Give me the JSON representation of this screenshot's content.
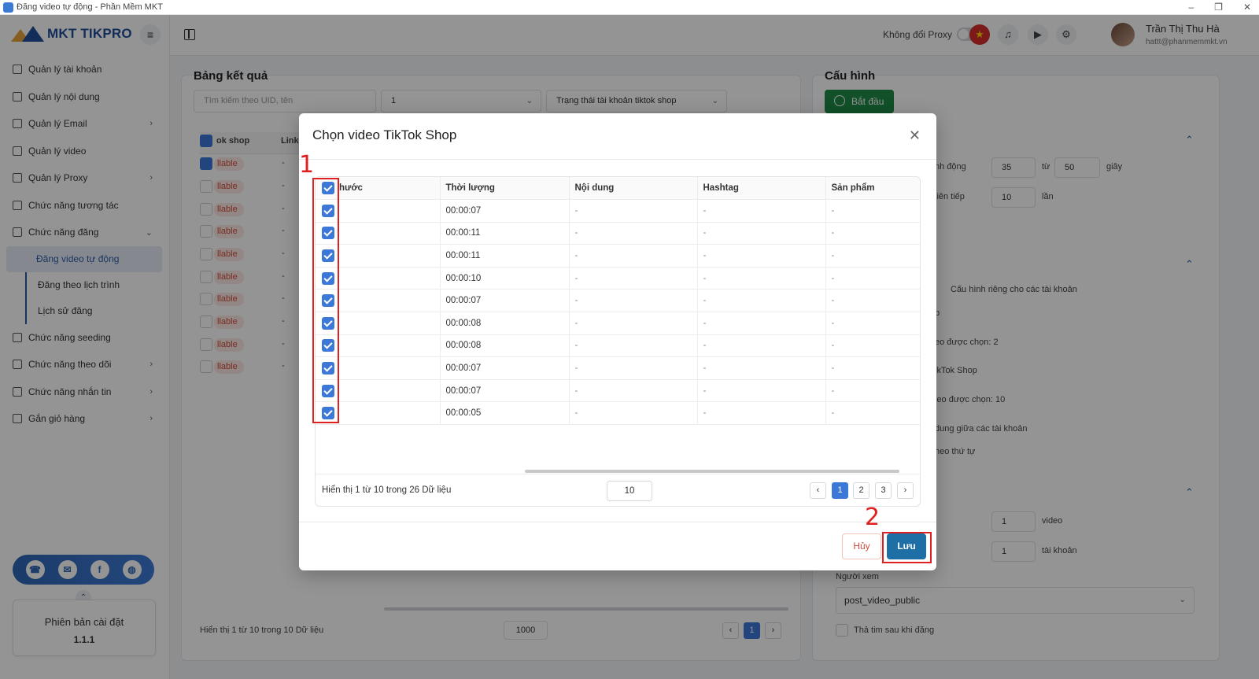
{
  "window": {
    "title": "Đăng video tự động - Phần Mềm MKT",
    "controls": [
      "–",
      "❐",
      "✕"
    ]
  },
  "sidebar": {
    "logo_text": "MKT TIKPRO",
    "items": [
      {
        "label": "Quản lý tài khoản",
        "icon": "grid-icon"
      },
      {
        "label": "Quản lý nội dung",
        "icon": "content-icon"
      },
      {
        "label": "Quản lý Email",
        "icon": "mail-icon",
        "chevron": "›"
      },
      {
        "label": "Quản lý video",
        "icon": "video-icon"
      },
      {
        "label": "Quản lý Proxy",
        "icon": "proxy-icon",
        "chevron": "›"
      },
      {
        "label": "Chức năng tương tác",
        "icon": "interact-icon"
      },
      {
        "label": "Chức năng đăng",
        "icon": "post-icon",
        "chevron": "⌄"
      }
    ],
    "sub_items": [
      {
        "label": "Đăng video tự động",
        "active": true
      },
      {
        "label": "Đăng theo lịch trình",
        "active": false
      },
      {
        "label": "Lịch sử đăng",
        "active": false
      }
    ],
    "items_after": [
      {
        "label": "Chức năng seeding",
        "icon": "seeding-icon"
      },
      {
        "label": "Chức năng theo dõi",
        "icon": "follow-icon",
        "chevron": "›"
      },
      {
        "label": "Chức năng nhắn tin",
        "icon": "message-icon",
        "chevron": "›"
      },
      {
        "label": "Gắn giỏ hàng",
        "icon": "cart-icon",
        "chevron": "›"
      }
    ],
    "version_label": "Phiên bản cài đặt",
    "version_number": "1.1.1"
  },
  "header": {
    "proxy_label": "Không đổi Proxy",
    "user_name": "Trần Thị Thu Hà",
    "user_email": "hattt@phanmemmkt.vn"
  },
  "results_panel": {
    "title": "Bảng kết quả",
    "search_placeholder": "Tìm kiếm theo UID, tên",
    "filter_value": "1",
    "status_placeholder": "Trạng thái tài khoản tiktok shop",
    "col_shop": "ok shop",
    "col_link": "Link",
    "badge_text": "llable",
    "dash": "-",
    "footer_text": "Hiển thị 1 từ 10 trong 10 Dữ liệu",
    "page_size": "1000",
    "page": "1"
  },
  "config_panel": {
    "title": "Cấu hình",
    "start_label": "Bắt đầu",
    "row1_label": "nh động",
    "row1_from": "35",
    "row1_to_label": "từ",
    "row1_to": "50",
    "row1_unit": "giây",
    "row2_label": "liên tiếp",
    "row2_value": "10",
    "row2_unit": "lần",
    "rieng_label": "Cấu hình riêng cho các tài khoản",
    "p_label": "p",
    "video_selected_1": "eo được chọn: 2",
    "tiktok_shop_label": "ikTok Shop",
    "video_selected_2": "leo được chọn: 10",
    "dung_label": "dung giữa các tài khoản",
    "order_label": "heo thứ tự",
    "v1": "1",
    "v1_unit": "video",
    "v2": "1",
    "v2_unit": "tài khoản",
    "viewer_label": "Người xem",
    "viewer_value": "post_video_public",
    "heart_label": "Thả tim sau khi đăng"
  },
  "modal": {
    "title": "Chọn video TikTok Shop",
    "columns": [
      "hước",
      "Thời lượng",
      "Nội dung",
      "Hashtag",
      "Sản phẩm"
    ],
    "rows": [
      {
        "duration": "00:00:07",
        "content": "-",
        "hashtag": "-",
        "product": "-"
      },
      {
        "duration": "00:00:11",
        "content": "-",
        "hashtag": "-",
        "product": "-"
      },
      {
        "duration": "00:00:11",
        "content": "-",
        "hashtag": "-",
        "product": "-"
      },
      {
        "duration": "00:00:10",
        "content": "-",
        "hashtag": "-",
        "product": "-"
      },
      {
        "duration": "00:00:07",
        "content": "-",
        "hashtag": "-",
        "product": "-"
      },
      {
        "duration": "00:00:08",
        "content": "-",
        "hashtag": "-",
        "product": "-"
      },
      {
        "duration": "00:00:08",
        "content": "-",
        "hashtag": "-",
        "product": "-"
      },
      {
        "duration": "00:00:07",
        "content": "-",
        "hashtag": "-",
        "product": "-"
      },
      {
        "duration": "00:00:07",
        "content": "-",
        "hashtag": "-",
        "product": "-"
      },
      {
        "duration": "00:00:05",
        "content": "-",
        "hashtag": "-",
        "product": "-"
      }
    ],
    "footer_text": "Hiển thị 1 từ 10 trong 26 Dữ liệu",
    "page_size": "10",
    "pages": [
      "1",
      "2",
      "3"
    ],
    "prev": "‹",
    "next": "›",
    "cancel_label": "Hủy",
    "save_label": "Lưu"
  },
  "annotations": {
    "one": "1",
    "two": "2"
  },
  "colors": {
    "primary": "#3b78d8",
    "start_green": "#1e8a48",
    "save_blue": "#1d6fa5",
    "annotation_red": "#e02020"
  }
}
